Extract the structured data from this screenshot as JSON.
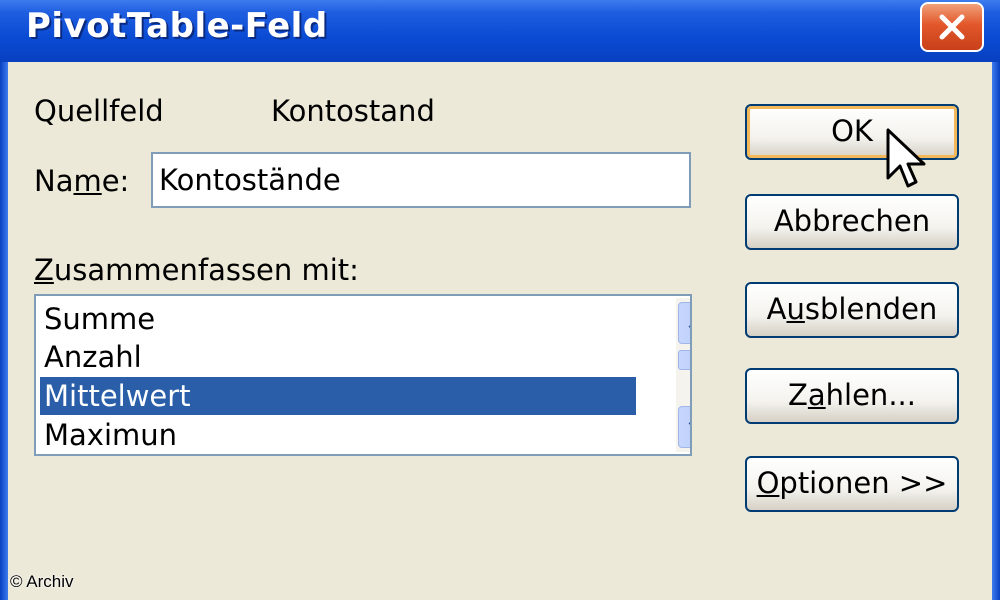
{
  "window": {
    "title": "PivotTable-Feld",
    "close_icon": "close-x-icon"
  },
  "source": {
    "label": "Quellfeld",
    "value": "Kontostand"
  },
  "name": {
    "label_pre": "Na",
    "label_accel": "m",
    "label_post": "e:",
    "value": "Kontostände"
  },
  "summarize": {
    "label_accel": "Z",
    "label_post": "usammenfassen mit:",
    "items": [
      "Summe",
      "Anzahl",
      "Mittelwert",
      "Maximun"
    ],
    "selected": "Mittelwert"
  },
  "buttons": {
    "ok": "OK",
    "cancel": "Abbrechen",
    "hide_pre": "A",
    "hide_accel": "u",
    "hide_post": "sblenden",
    "numbers_pre": "Z",
    "numbers_accel": "a",
    "numbers_post": "hlen...",
    "options_accel": "O",
    "options_post": "ptionen >>"
  },
  "credit": "© Archiv",
  "colors": {
    "titlebar": "#0a4bd4",
    "selection": "#2a5ea8",
    "close": "#e2572a",
    "default_button_glow": "#f3b85a"
  }
}
